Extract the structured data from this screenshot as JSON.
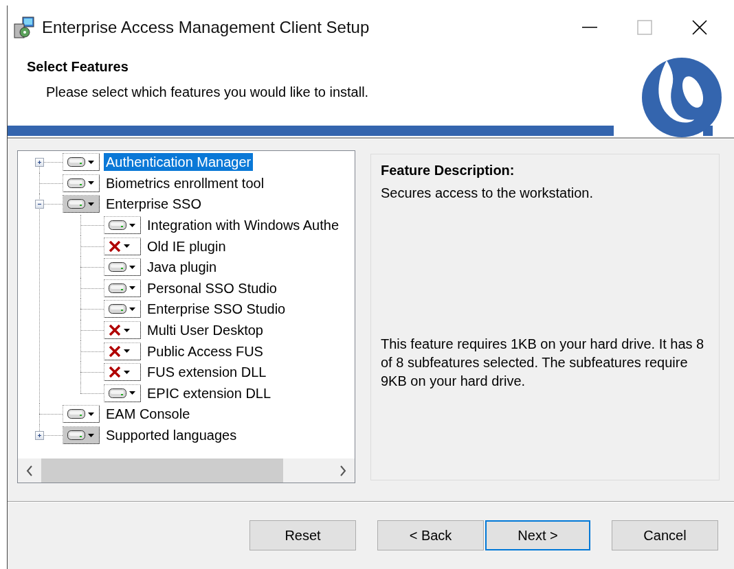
{
  "window": {
    "title": "Enterprise Access Management Client Setup"
  },
  "header": {
    "title": "Select Features",
    "subtitle": "Please select which features you would like to install."
  },
  "tree": {
    "items": [
      {
        "label": "Authentication Manager",
        "kind": "install",
        "selected": true,
        "expanded": false
      },
      {
        "label": "Biometrics enrollment tool",
        "kind": "install",
        "selected": false
      },
      {
        "label": "Enterprise SSO",
        "kind": "partial",
        "selected": false,
        "expanded": true,
        "children": [
          {
            "label": "Integration with Windows Authe",
            "kind": "install",
            "selected": false
          },
          {
            "label": "Old IE plugin",
            "kind": "excluded",
            "selected": false
          },
          {
            "label": "Java plugin",
            "kind": "install",
            "selected": false
          },
          {
            "label": "Personal SSO Studio",
            "kind": "install",
            "selected": false
          },
          {
            "label": "Enterprise SSO Studio",
            "kind": "install",
            "selected": false
          },
          {
            "label": "Multi User Desktop",
            "kind": "excluded",
            "selected": false
          },
          {
            "label": "Public Access FUS",
            "kind": "excluded",
            "selected": false
          },
          {
            "label": "FUS extension DLL",
            "kind": "excluded",
            "selected": false
          },
          {
            "label": "EPIC extension DLL",
            "kind": "install",
            "selected": false
          }
        ]
      },
      {
        "label": "EAM Console",
        "kind": "install",
        "selected": false
      },
      {
        "label": "Supported languages",
        "kind": "partial",
        "selected": false,
        "expanded": false
      }
    ]
  },
  "description": {
    "title": "Feature Description:",
    "text": "Secures access to the workstation.",
    "size_text": "This feature requires 1KB on your hard drive. It has 8 of 8 subfeatures selected. The subfeatures require 9KB on your hard drive."
  },
  "buttons": [
    {
      "label": "Reset",
      "focused": false
    },
    {
      "label": "< Back",
      "focused": false
    },
    {
      "label": "Next >",
      "focused": true
    },
    {
      "label": "Cancel",
      "focused": false
    }
  ]
}
